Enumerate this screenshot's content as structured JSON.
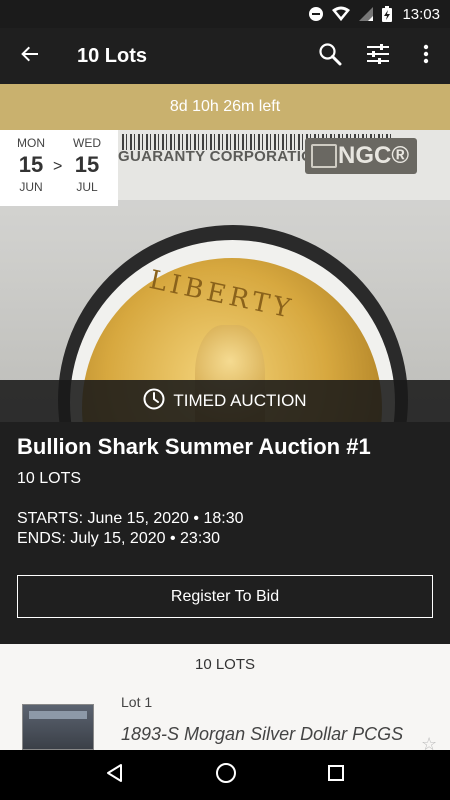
{
  "status": {
    "time": "13:03"
  },
  "app_bar": {
    "title": "10 Lots"
  },
  "countdown": {
    "text": "8d 10h 26m left"
  },
  "hero": {
    "slab_text": "GUARANTY CORPORATION",
    "slab_logo": "NGC®",
    "coin_legend": "LIBERTY"
  },
  "date_box": {
    "start": {
      "dow": "MON",
      "day": "15",
      "month": "JUN"
    },
    "end": {
      "dow": "WED",
      "day": "15",
      "month": "JUL"
    },
    "separator": ">"
  },
  "timed_label": "TIMED AUCTION",
  "auction": {
    "title": "Bullion Shark Summer Auction #1",
    "lots": "10 LOTS",
    "starts": "STARTS: June 15, 2020 • 18:30",
    "ends": "ENDS: July 15, 2020 • 23:30",
    "register_label": "Register To Bid"
  },
  "lots_section": {
    "header": "10 LOTS",
    "items": [
      {
        "number": "Lot 1",
        "title": "1893-S Morgan Silver Dollar PCGS"
      }
    ]
  },
  "icons": {
    "back": "arrow-back-icon",
    "search": "search-icon",
    "filter": "tune-icon",
    "menu": "more-vert-icon",
    "clock": "clock-icon",
    "star": "star-outline-icon"
  },
  "colors": {
    "accent_gold": "#c9b16e",
    "background_dark": "#1f1f1f",
    "lots_background": "#f7f6f4"
  }
}
